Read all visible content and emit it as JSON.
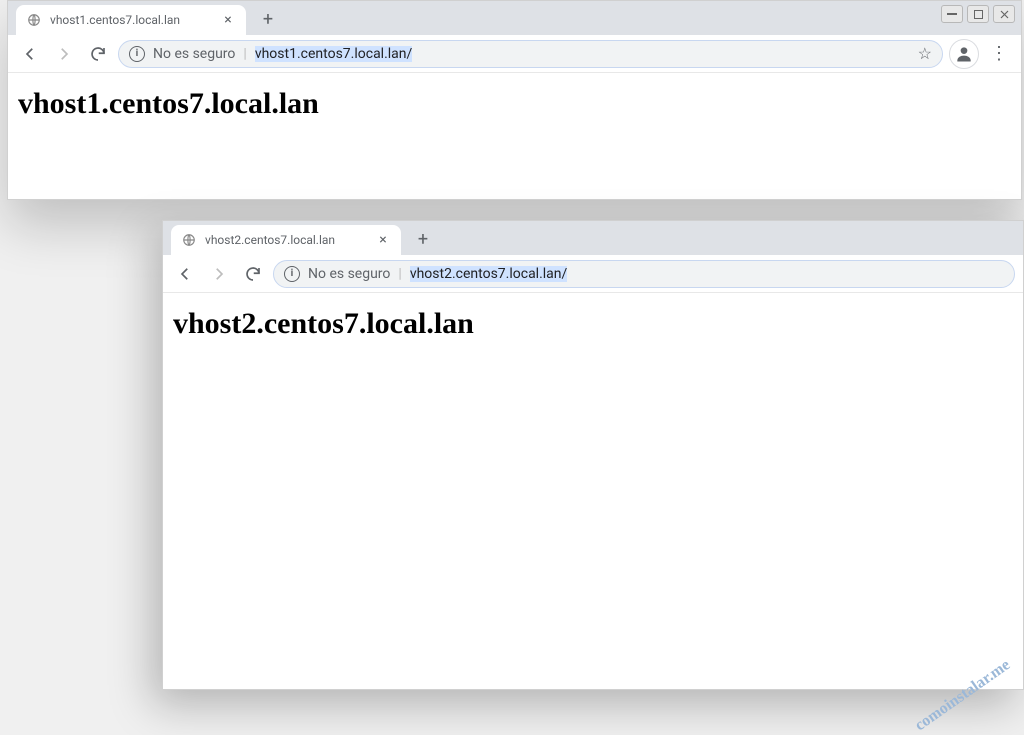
{
  "window1": {
    "tab": {
      "title": "vhost1.centos7.local.lan"
    },
    "addressbar": {
      "security_label": "No es seguro",
      "url": "vhost1.centos7.local.lan/"
    },
    "page": {
      "heading": "vhost1.centos7.local.lan"
    }
  },
  "window2": {
    "tab": {
      "title": "vhost2.centos7.local.lan"
    },
    "addressbar": {
      "security_label": "No es seguro",
      "url": "vhost2.centos7.local.lan/"
    },
    "page": {
      "heading": "vhost2.centos7.local.lan"
    }
  },
  "watermark": "comoinstalar.me"
}
